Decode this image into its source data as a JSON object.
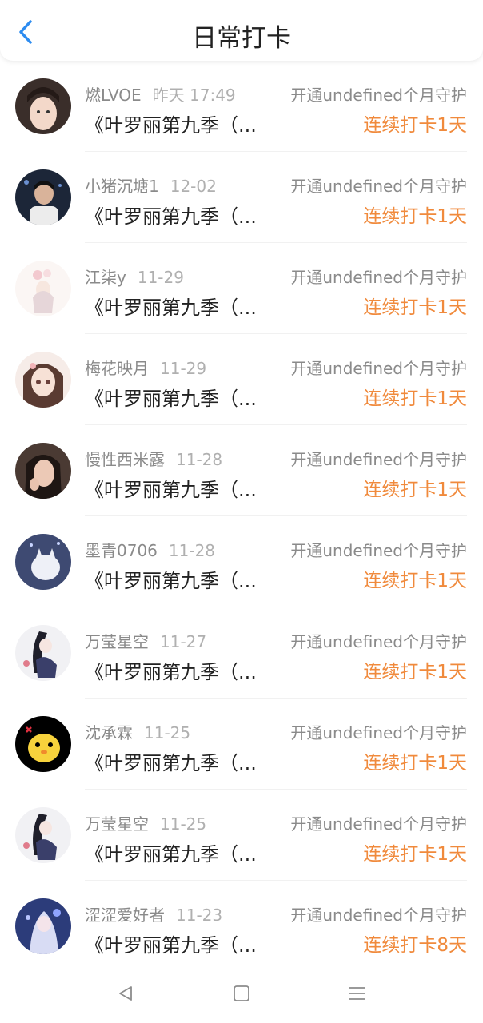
{
  "header": {
    "title": "日常打卡"
  },
  "icons": {
    "back": "chevron-left-icon",
    "nav_back": "triangle-back-icon",
    "nav_home": "square-home-icon",
    "nav_menu": "menu-icon"
  },
  "colors": {
    "accent": "#f08a3c",
    "back": "#2d8cf0"
  },
  "items": [
    {
      "name": "燃LVOE",
      "date": "昨天 17:49",
      "guard": "开通undefined个月守护",
      "content": "《叶罗丽第九季（...",
      "streak": "连续打卡1天"
    },
    {
      "name": "小猪沉塘1",
      "date": "12-02",
      "guard": "开通undefined个月守护",
      "content": "《叶罗丽第九季（...",
      "streak": "连续打卡1天"
    },
    {
      "name": "江柒y",
      "date": "11-29",
      "guard": "开通undefined个月守护",
      "content": "《叶罗丽第九季（...",
      "streak": "连续打卡1天"
    },
    {
      "name": "梅花映月",
      "date": "11-29",
      "guard": "开通undefined个月守护",
      "content": "《叶罗丽第九季（...",
      "streak": "连续打卡1天"
    },
    {
      "name": "慢性西米露",
      "date": "11-28",
      "guard": "开通undefined个月守护",
      "content": "《叶罗丽第九季（...",
      "streak": "连续打卡1天"
    },
    {
      "name": "墨青0706",
      "date": "11-28",
      "guard": "开通undefined个月守护",
      "content": "《叶罗丽第九季（...",
      "streak": "连续打卡1天"
    },
    {
      "name": "万莹星空",
      "date": "11-27",
      "guard": "开通undefined个月守护",
      "content": "《叶罗丽第九季（...",
      "streak": "连续打卡1天"
    },
    {
      "name": "沈承霖",
      "date": "11-25",
      "guard": "开通undefined个月守护",
      "content": "《叶罗丽第九季（...",
      "streak": "连续打卡1天"
    },
    {
      "name": "万莹星空",
      "date": "11-25",
      "guard": "开通undefined个月守护",
      "content": "《叶罗丽第九季（...",
      "streak": "连续打卡1天"
    },
    {
      "name": "涩涩爱好者",
      "date": "11-23",
      "guard": "开通undefined个月守护",
      "content": "《叶罗丽第九季（...",
      "streak": "连续打卡8天"
    }
  ]
}
